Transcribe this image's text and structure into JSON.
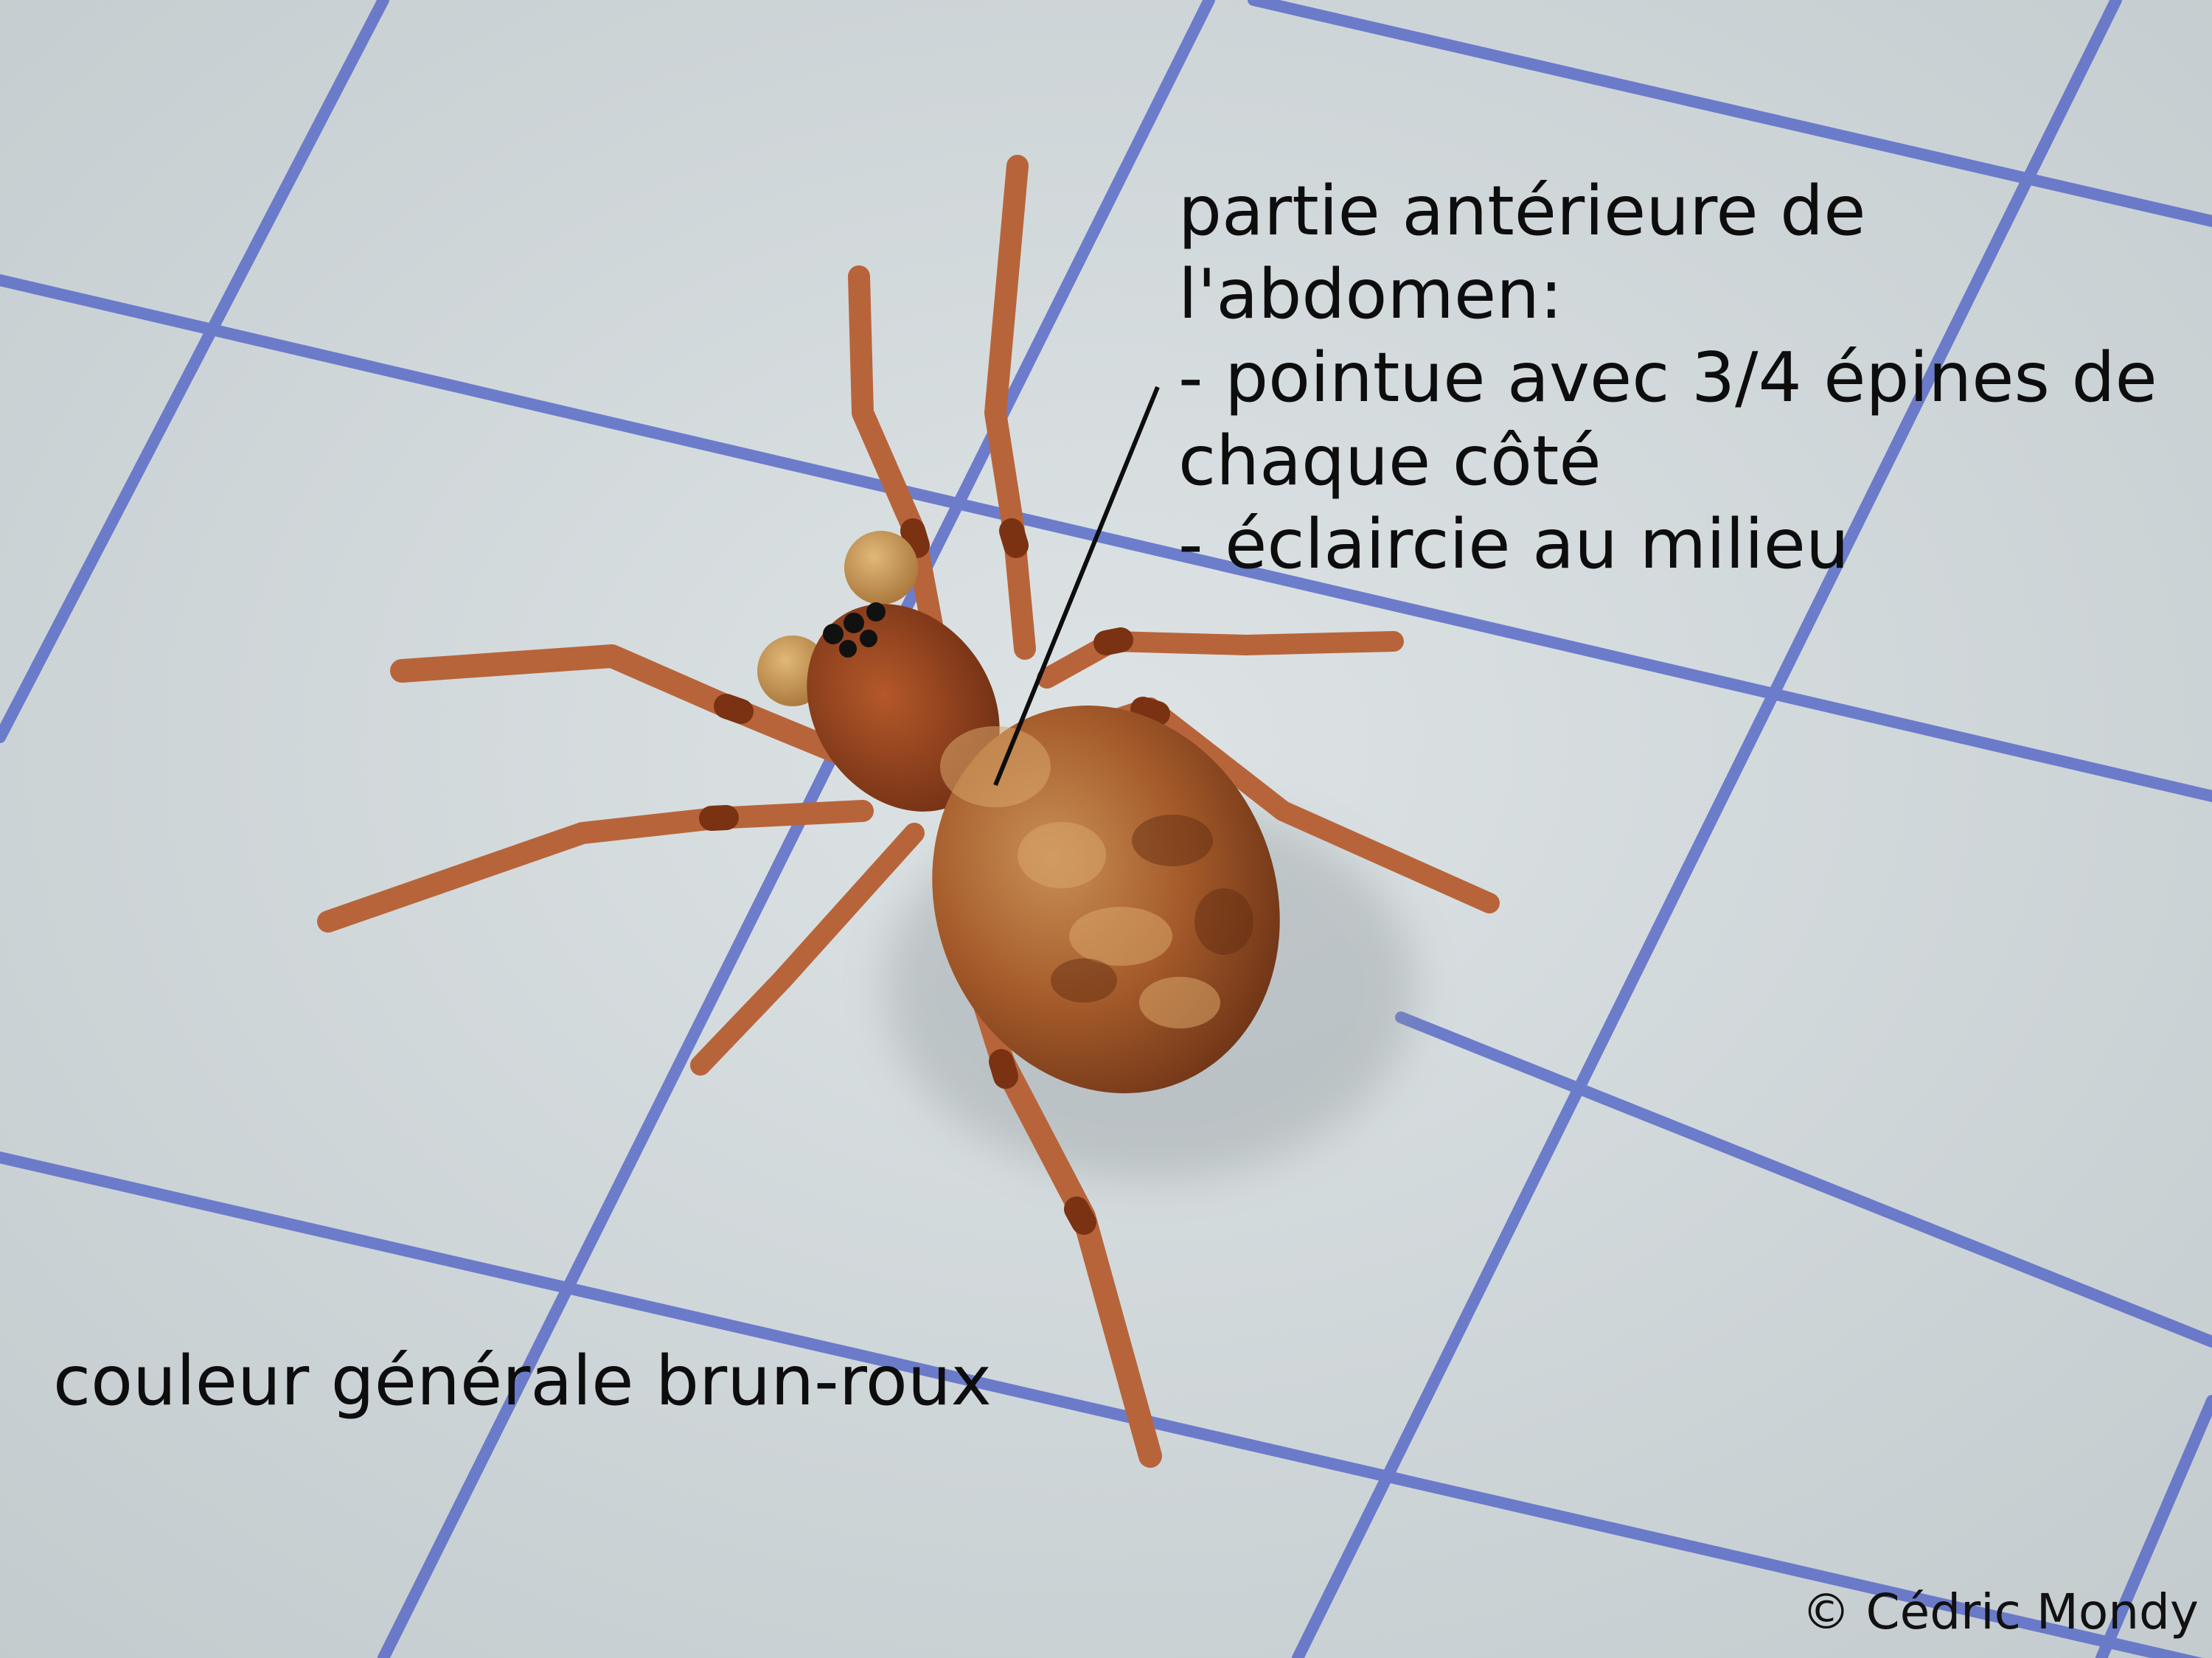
{
  "annotations": {
    "anterior_abdomen": [
      "partie antérieure de",
      "l'abdomen:",
      "- pointue avec 3/4 épines de",
      "chaque côté",
      "- éclaircie au milieu"
    ],
    "general_color": "couleur générale brun-roux"
  },
  "credit": "© Cédric Mondy",
  "colors": {
    "paper": "#cfd6d8",
    "grid_lines": "#5a6cc8",
    "spider_body": "#9a4a22",
    "spider_legs": "#b8643a",
    "text": "#0d0d0d"
  }
}
